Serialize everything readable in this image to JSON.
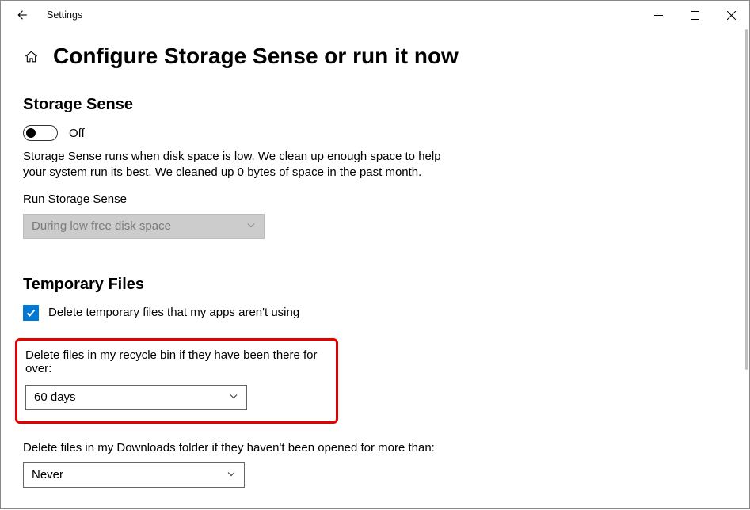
{
  "app_title": "Settings",
  "page_title": "Configure Storage Sense or run it now",
  "storage_sense": {
    "heading": "Storage Sense",
    "toggle_state": "Off",
    "description": "Storage Sense runs when disk space is low. We clean up enough space to help your system run its best. We cleaned up 0 bytes of space in the past month.",
    "run_label": "Run Storage Sense",
    "run_value": "During low free disk space"
  },
  "temporary_files": {
    "heading": "Temporary Files",
    "delete_unused_label": "Delete temporary files that my apps aren't using",
    "delete_unused_checked": true,
    "recycle_bin_label": "Delete files in my recycle bin if they have been there for over:",
    "recycle_bin_value": "60 days",
    "downloads_label": "Delete files in my Downloads folder if they haven't been opened for more than:",
    "downloads_value": "Never"
  },
  "icons": {
    "back": "back-arrow",
    "home": "home-outline",
    "min": "minimize",
    "max": "maximize",
    "close": "close",
    "chevron": "chevron-down",
    "check": "checkmark"
  }
}
